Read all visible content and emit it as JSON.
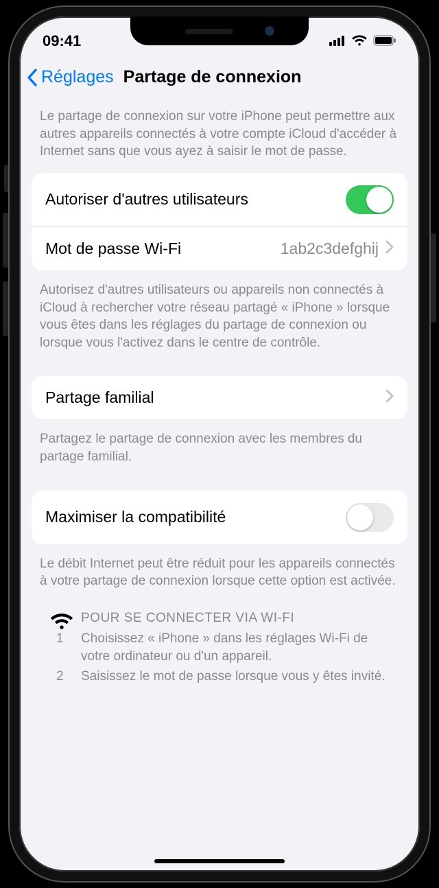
{
  "status": {
    "time": "09:41"
  },
  "nav": {
    "back": "Réglages",
    "title": "Partage de connexion"
  },
  "section1": {
    "hint": "Le partage de connexion sur votre iPhone peut permettre aux autres appareils connectés à votre compte iCloud d'accéder à Internet sans que vous ayez à saisir le mot de passe.",
    "allow_label": "Autoriser d'autres utilisateurs",
    "allow_on": true,
    "pw_label": "Mot de passe Wi-Fi",
    "pw_value": "1ab2c3defghij",
    "foot": "Autorisez d'autres utilisateurs ou appareils non connectés à iCloud à rechercher votre réseau partagé « iPhone » lorsque vous êtes dans les réglages du partage de connexion ou lorsque vous l'activez dans le centre de contrôle."
  },
  "section2": {
    "family_label": "Partage familial",
    "foot": "Partagez le partage de connexion avec les membres du partage familial."
  },
  "section3": {
    "compat_label": "Maximiser la compatibilité",
    "compat_on": false,
    "foot": "Le débit Internet peut être réduit pour les appareils connectés à votre partage de connexion lorsque cette option est activée."
  },
  "instructions": {
    "heading": "POUR SE CONNECTER VIA WI-FI",
    "step1_n": "1",
    "step1": "Choisissez « iPhone » dans les réglages Wi-Fi de votre ordinateur ou d'un appareil.",
    "step2_n": "2",
    "step2": "Saisissez le mot de passe lorsque vous y êtes invité."
  }
}
